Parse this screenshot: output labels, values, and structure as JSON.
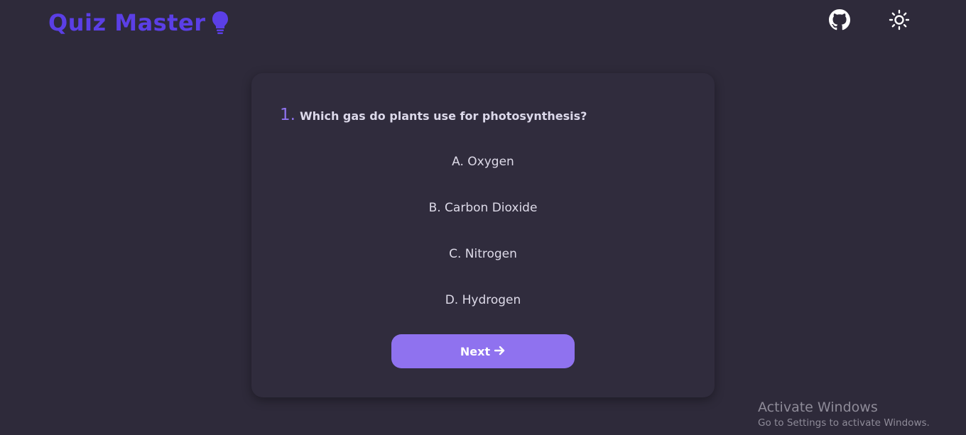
{
  "header": {
    "app_title": "Quiz Master",
    "logo_icon": "lightbulb-icon",
    "github_icon": "github-icon",
    "theme_toggle_icon": "sun-icon"
  },
  "quiz": {
    "question_number": "1.",
    "question_text": "Which gas do plants use for photosynthesis?",
    "options": [
      "A. Oxygen",
      "B. Carbon Dioxide",
      "C. Nitrogen",
      "D. Hydrogen"
    ],
    "next_label": "Next",
    "next_icon": "arrow-right-icon"
  },
  "os_watermark": {
    "title": "Activate Windows",
    "subtitle": "Go to Settings to activate Windows."
  },
  "colors": {
    "background": "#2e2a3a",
    "card": "#302c3d",
    "brand": "#5b3fe6",
    "accent": "#8f72ef",
    "text": "#dedbe9"
  }
}
